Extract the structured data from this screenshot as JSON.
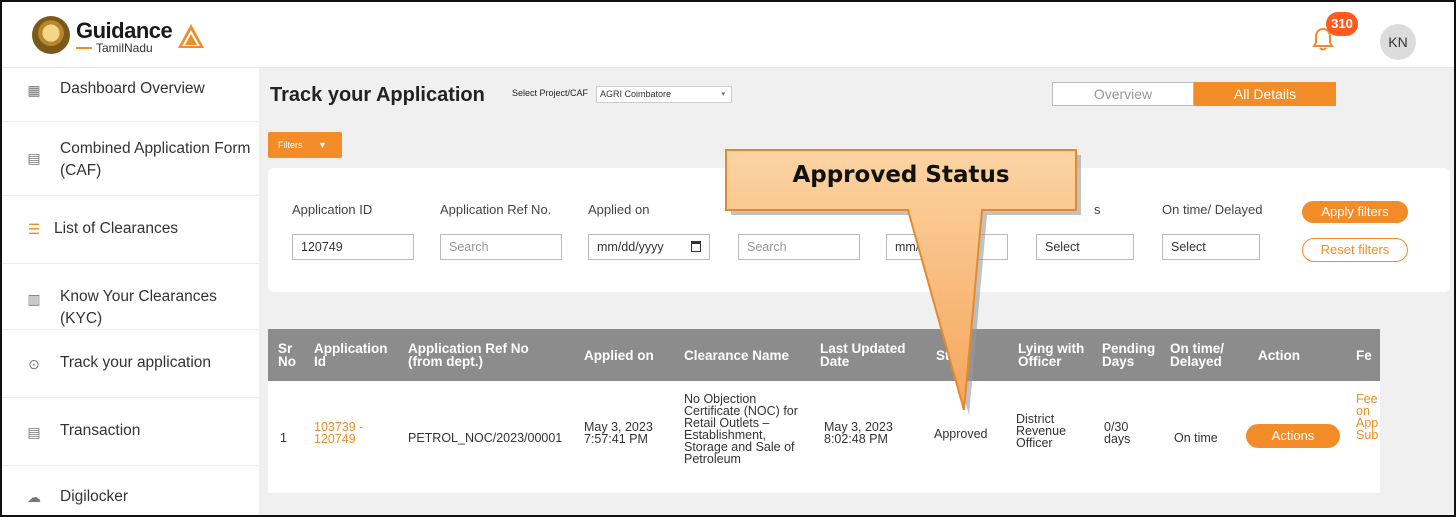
{
  "header": {
    "logo_title": "Guidance",
    "logo_subtitle": "TamilNadu",
    "notification_count": "310",
    "user_initials": "KN"
  },
  "sidebar": {
    "items": [
      {
        "label": "Dashboard Overview",
        "icon": "grid-icon"
      },
      {
        "label": "Combined Application Form (CAF)",
        "icon": "document-icon"
      },
      {
        "label": "List of Clearances",
        "icon": "list-icon"
      },
      {
        "label": "Know Your Clearances (KYC)",
        "icon": "book-icon"
      },
      {
        "label": "Track your application",
        "icon": "location-pin-icon"
      },
      {
        "label": "Transaction",
        "icon": "receipt-icon"
      },
      {
        "label": "Digilocker",
        "icon": "cloud-icon"
      }
    ]
  },
  "main": {
    "title": "Track your Application",
    "project_label": "Select Project/CAF",
    "project_value": "AGRI Coimbatore",
    "tab_overview": "Overview",
    "tab_all_details": "All Details",
    "filters_label": "Filters"
  },
  "filters": {
    "application_id_label": "Application ID",
    "application_id_value": "120749",
    "ref_no_label": "Application Ref No.",
    "ref_no_placeholder": "Search",
    "applied_on_label": "Applied on",
    "applied_on_placeholder": "mm/dd/yyyy",
    "clearance_placeholder": "Search",
    "date2_placeholder": "mm/dd",
    "status_label": "s",
    "status_placeholder": "Select",
    "ontime_label": "On time/ Delayed",
    "ontime_placeholder": "Select",
    "apply_label": "Apply filters",
    "reset_label": "Reset filters"
  },
  "table": {
    "headers": {
      "sr": "Sr No",
      "app_id": "Application Id",
      "app_ref": "Application Ref No (from dept.)",
      "applied_on": "Applied on",
      "clearance": "Clearance Name",
      "last_updated": "Last Updated Date",
      "status": "Stat",
      "lying_with": "Lying with Officer",
      "pending": "Pending Days",
      "ontime": "On time/ Delayed",
      "action": "Action",
      "fee": "Fe"
    },
    "rows": [
      {
        "sr": "1",
        "app_id": "103739 - 120749",
        "app_ref": "PETROL_NOC/2023/00001",
        "applied_on": "May 3, 2023 7:57:41 PM",
        "clearance": "No Objection Certificate (NOC) for Retail Outlets – Establishment, Storage and Sale of Petroleum",
        "last_updated": "May 3, 2023 8:02:48 PM",
        "status": "Approved",
        "lying_with": "District Revenue Officer",
        "pending": "0/30 days",
        "ontime": "On time",
        "action": "Actions",
        "fee": "Fee on App Sub"
      }
    ]
  },
  "callout": {
    "text": "Approved Status"
  },
  "colors": {
    "accent": "#f28c28",
    "header_row": "#8c8c8c",
    "badge": "#ff5a1f"
  }
}
